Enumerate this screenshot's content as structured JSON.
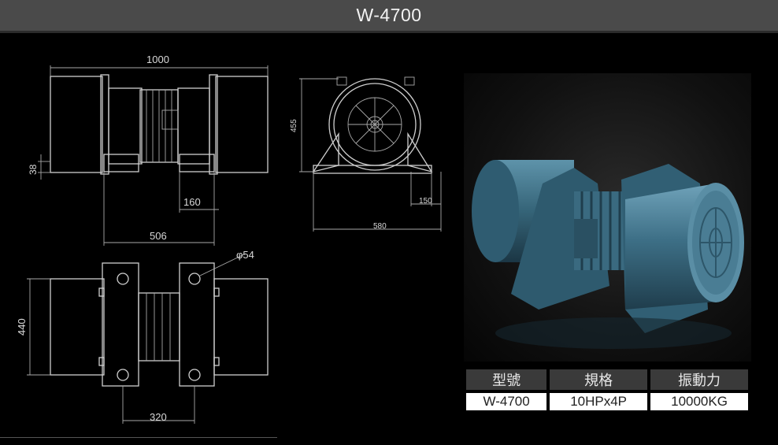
{
  "header": {
    "title": "W-4700"
  },
  "drawings": {
    "top_view": {
      "width_dim": "1000",
      "offset_dim": "38",
      "foot_dim": "160",
      "base_dim": "506"
    },
    "side_view": {
      "height_dim": "455",
      "foot_dim": "150",
      "base_dim": "580"
    },
    "plan_view": {
      "hole_dim": "φ54",
      "depth_dim": "440",
      "spacing_dim": "320"
    }
  },
  "product_photo": {
    "description": "vibration-motor-render",
    "color": "#3d6f86"
  },
  "spec_table": {
    "headers": [
      "型號",
      "規格",
      "振動力"
    ],
    "values": [
      "W-4700",
      "10HPx4P",
      "10000KG"
    ]
  },
  "colors": {
    "header_bg": "#4a4a4a",
    "table_header_bg": "#3a3a3a",
    "motor_blue": "#3d6f86"
  }
}
